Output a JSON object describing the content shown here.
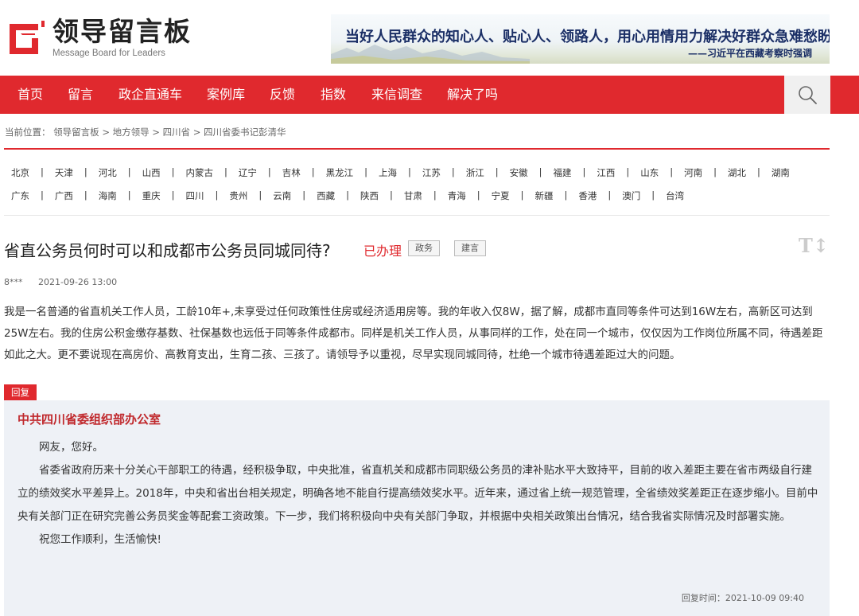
{
  "header": {
    "logo_cn": "领导留言板",
    "logo_en": "Message Board for Leaders",
    "banner_quote": "当好人民群众的知心人、贴心人、领路人，用心用情用力解决好群众急难愁盼问题。",
    "banner_attr": "——习近平在西藏考察时强调"
  },
  "nav": {
    "items": [
      "首页",
      "留言",
      "政企直通车",
      "案例库",
      "反馈",
      "指数",
      "来信调查",
      "解决了吗"
    ],
    "search_icon": "search-icon"
  },
  "breadcrumb": {
    "prefix": "当前位置：",
    "items": [
      "领导留言板",
      "地方领导",
      "四川省",
      "四川省委书记彭清华"
    ],
    "separator": ">"
  },
  "provinces": {
    "row1": [
      "北京",
      "天津",
      "河北",
      "山西",
      "内蒙古",
      "辽宁",
      "吉林",
      "黑龙江",
      "上海",
      "江苏",
      "浙江",
      "安徽",
      "福建",
      "江西",
      "山东",
      "河南",
      "湖北",
      "湖南"
    ],
    "row2": [
      "广东",
      "广西",
      "海南",
      "重庆",
      "四川",
      "贵州",
      "云南",
      "西藏",
      "陕西",
      "甘肃",
      "青海",
      "宁夏",
      "新疆",
      "香港",
      "澳门",
      "台湾"
    ]
  },
  "message": {
    "title": "省直公务员何时可以和成都市公务员同城同待?",
    "status": "已办理",
    "tags": [
      "政务",
      "建言"
    ],
    "font_tool": "T↕",
    "author": "8***",
    "date": "2021-09-26 13:00",
    "body": "我是一名普通的省直机关工作人员，工龄10年+,未享受过任何政策性住房或经济适用房等。我的年收入仅8W，据了解，成都市直同等条件可达到16W左右，高新区可达到25W左右。我的住房公积金缴存基数、社保基数也远低于同等条件成都市。同样是机关工作人员，从事同样的工作，处在同一个城市，仅仅因为工作岗位所属不同，待遇差距如此之大。更不要说现在高房价、高教育支出，生育二孩、三孩了。请领导予以重视，尽早实现同城同待，杜绝一个城市待遇差距过大的问题。"
  },
  "reply": {
    "tab": "回复",
    "org": "中共四川省委组织部办公室",
    "greeting": "网友，您好。",
    "para1": "省委省政府历来十分关心干部职工的待遇，经积极争取，中央批准，省直机关和成都市同职级公务员的津补贴水平大致持平，目前的收入差距主要在省市两级自行建立的绩效奖水平差异上。2018年，中央和省出台相关规定，明确各地不能自行提高绩效奖水平。近年来，通过省上统一规范管理，全省绩效奖差距正在逐步缩小。目前中央有关部门正在研究完善公务员奖金等配套工资政策。下一步，我们将积极向中央有关部门争取，并根据中央相关政策出台情况，结合我省实际情况及时部署实施。",
    "closing": "祝您工作顺利，生活愉快!",
    "time_label": "回复时间：",
    "time": "2021-10-09 09:40"
  },
  "colors": {
    "brand_red": "#e0292e",
    "reply_bg": "#eef1f6",
    "banner_text": "#1b2f66"
  }
}
